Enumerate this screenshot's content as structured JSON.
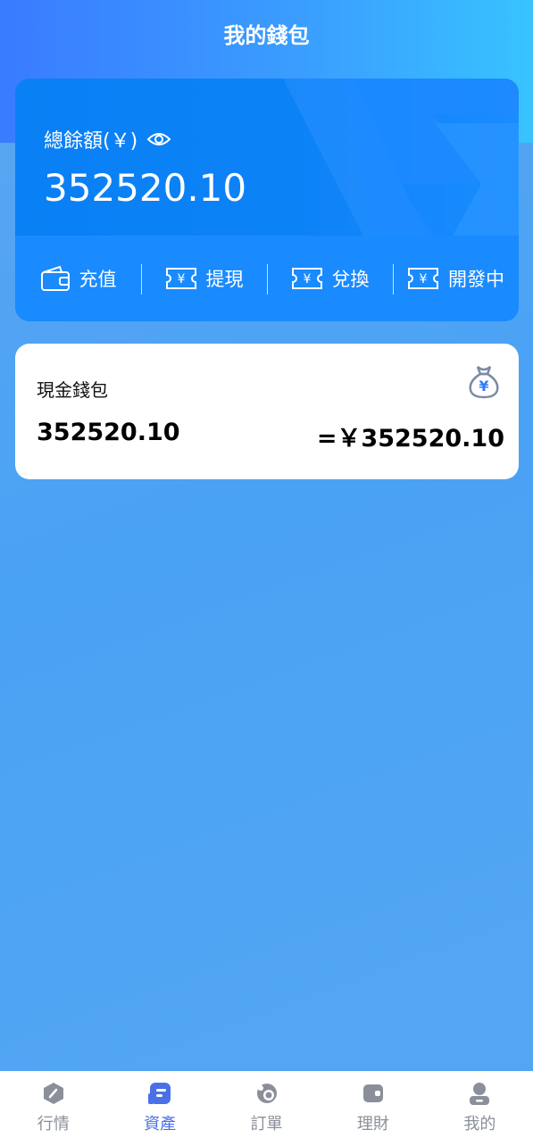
{
  "header": {
    "title": "我的錢包"
  },
  "balance": {
    "label": "總餘額(￥)",
    "value": "352520.10"
  },
  "actions": [
    {
      "label": "充值",
      "icon": "wallet-icon"
    },
    {
      "label": "提現",
      "icon": "ticket-yen-icon"
    },
    {
      "label": "兌換",
      "icon": "ticket-yen-icon"
    },
    {
      "label": "開發中",
      "icon": "ticket-yen-icon"
    }
  ],
  "wallet": {
    "name": "現金錢包",
    "amount": "352520.10",
    "equivalent": "=￥352520.10",
    "icon": "money-bag-icon"
  },
  "tabs": [
    {
      "label": "行情",
      "icon": "compass-icon",
      "active": false
    },
    {
      "label": "資產",
      "icon": "document-icon",
      "active": true
    },
    {
      "label": "訂單",
      "icon": "orders-icon",
      "active": false
    },
    {
      "label": "理財",
      "icon": "wallet-icon",
      "active": false
    },
    {
      "label": "我的",
      "icon": "user-icon",
      "active": false
    }
  ],
  "colors": {
    "accent": "#4a70e8",
    "inactive": "#8a8f99",
    "card_blue": "#1a8aff"
  }
}
